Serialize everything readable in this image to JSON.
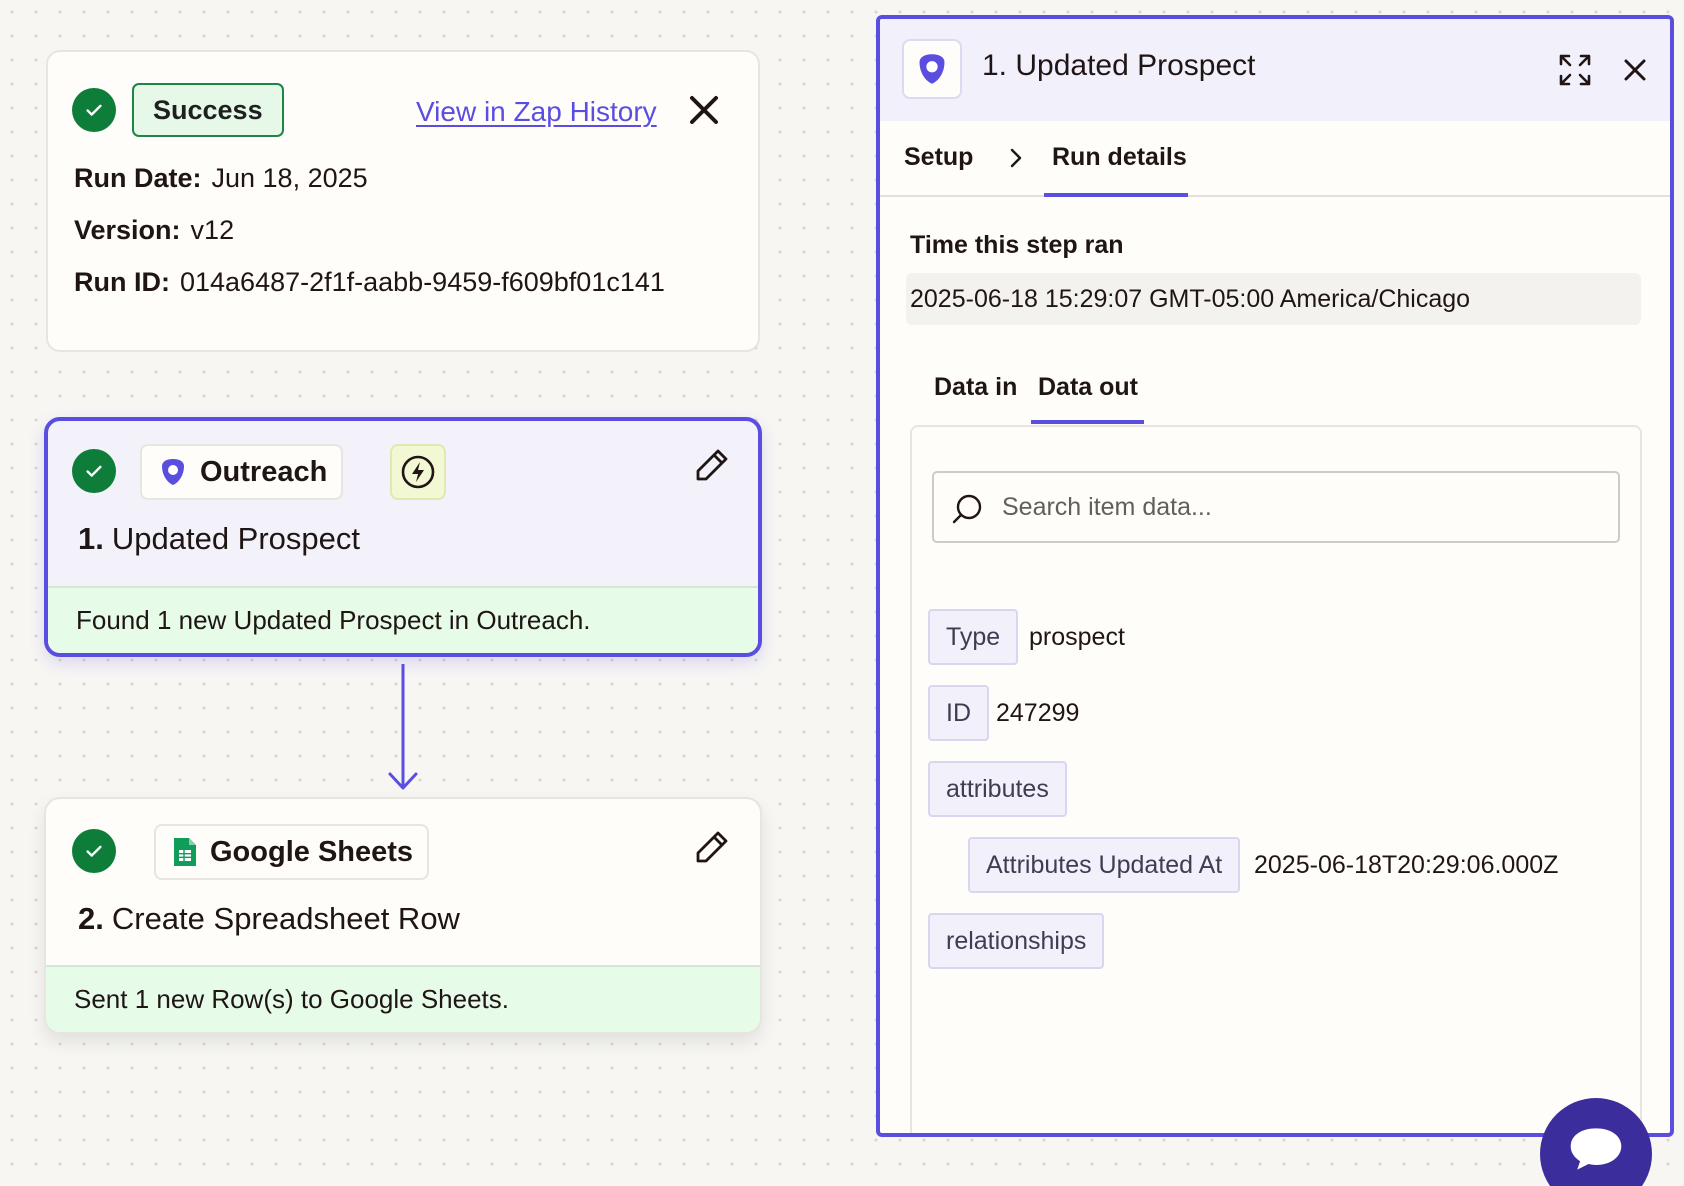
{
  "run_summary": {
    "status": "Success",
    "history_link": "View in Zap History",
    "rows": [
      {
        "label": "Run Date:",
        "value": "Jun 18, 2025"
      },
      {
        "label": "Version:",
        "value": "v12"
      },
      {
        "label": "Run ID:",
        "value": "014a6487-2f1f-aabb-9459-f609bf01c141"
      }
    ]
  },
  "steps": [
    {
      "number": "1.",
      "title": "Updated Prospect",
      "app": "Outreach",
      "result": "Found 1 new Updated Prospect in Outreach."
    },
    {
      "number": "2.",
      "title": "Create Spreadsheet Row",
      "app": "Google Sheets",
      "result": "Sent 1 new Row(s) to Google Sheets."
    }
  ],
  "panel": {
    "title": "1. Updated Prospect",
    "nav": {
      "setup": "Setup",
      "run_details": "Run details"
    },
    "time_label": "Time this step ran",
    "time_value": "2025-06-18 15:29:07 GMT-05:00 America/Chicago",
    "data_tabs": {
      "data_in": "Data in",
      "data_out": "Data out"
    },
    "search_placeholder": "Search item data...",
    "fields": [
      {
        "key": "Type",
        "value": "prospect"
      },
      {
        "key": "ID",
        "value": "247299"
      },
      {
        "key": "attributes",
        "value": ""
      },
      {
        "key": "Attributes Updated At",
        "value": "2025-06-18T20:29:06.000Z"
      },
      {
        "key": "relationships",
        "value": ""
      }
    ]
  },
  "colors": {
    "accent": "#5a4ee0",
    "success": "#0e7d3a",
    "success_bg": "#e6fbe8",
    "chat": "#3b2e9c"
  },
  "icons": [
    "check-icon",
    "close-icon",
    "outreach-logo-icon",
    "bolt-icon",
    "pencil-icon",
    "google-sheets-icon",
    "arrow-down-icon",
    "expand-icon",
    "chevron-right-icon",
    "search-icon",
    "chat-icon"
  ]
}
